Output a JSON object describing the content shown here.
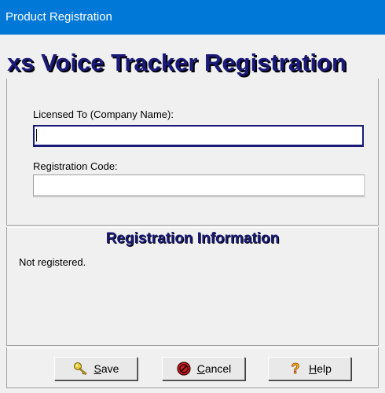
{
  "window": {
    "title": "Product Registration"
  },
  "header": {
    "title": "xs Voice Tracker Registration"
  },
  "form": {
    "licensed_label": "Licensed To (Company Name):",
    "licensed_value": "",
    "code_label": "Registration Code:",
    "code_value": ""
  },
  "info": {
    "title": "Registration Information",
    "status": "Not registered."
  },
  "buttons": {
    "save": {
      "mnemonic": "S",
      "rest": "ave"
    },
    "cancel": {
      "mnemonic": "C",
      "rest": "ancel"
    },
    "help": {
      "mnemonic": "H",
      "rest": "elp"
    }
  },
  "icons": {
    "save": "key-icon",
    "cancel": "cancel-icon",
    "help": "question-icon"
  },
  "colors": {
    "titlebar": "#0078d7",
    "heading": "#1a1a7a",
    "background": "#f0f0f0"
  }
}
